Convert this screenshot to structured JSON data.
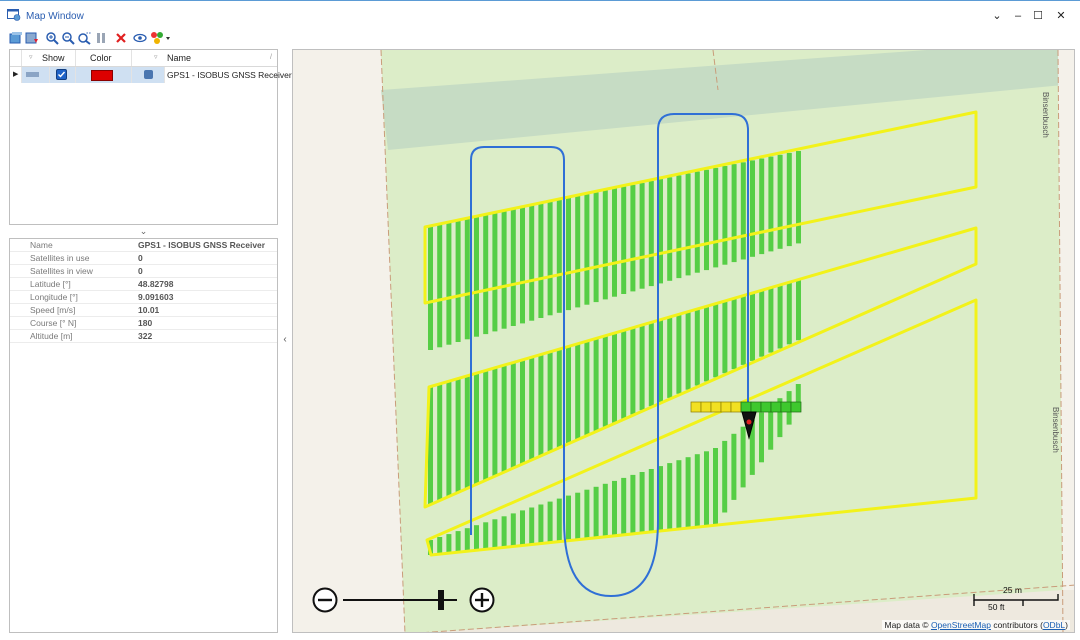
{
  "window": {
    "title": "Map Window",
    "controls": [
      "⌄",
      "–",
      "☐",
      "✕"
    ]
  },
  "toolbar": {
    "icons": [
      "open-map-icon",
      "load-layer-icon",
      "zoom-in-icon",
      "zoom-out-icon",
      "zoom-reset-icon",
      "pause-icon",
      "delete-icon",
      "visibility-icon",
      "color-options-icon"
    ]
  },
  "grid": {
    "columns": [
      "Show",
      "Color",
      "Name"
    ],
    "rows": [
      {
        "show": true,
        "color": "#dd0000",
        "name": "GPS1 - ISOBUS GNSS Receiver"
      }
    ]
  },
  "properties": [
    {
      "name": "Name",
      "value": "GPS1 - ISOBUS GNSS Receiver"
    },
    {
      "name": "Satellites in use",
      "value": "0"
    },
    {
      "name": "Satellites in view",
      "value": "0"
    },
    {
      "name": "Latitude [°]",
      "value": "48.82798"
    },
    {
      "name": "Longitude [°]",
      "value": "9.091603"
    },
    {
      "name": "Speed [m/s]",
      "value": "10.01"
    },
    {
      "name": "Course [° N]",
      "value": "180"
    },
    {
      "name": "Altitude [m]",
      "value": "322"
    }
  ],
  "map": {
    "street_labels": [
      "Binsenbusch",
      "Binsenbusch"
    ],
    "scale": {
      "metric": "25 m",
      "imperial": "50 ft"
    },
    "zoom_level": 0.86,
    "attribution": {
      "prefix": "Map data ©",
      "link": "OpenStreetMap",
      "middle": "contributors (",
      "license": "ODbL",
      "suffix": ")"
    },
    "colors": {
      "field": "#dcedc8",
      "boundary": "#f2f21a",
      "coverage": "#3ec82e",
      "route": "#2f6fd6"
    }
  }
}
